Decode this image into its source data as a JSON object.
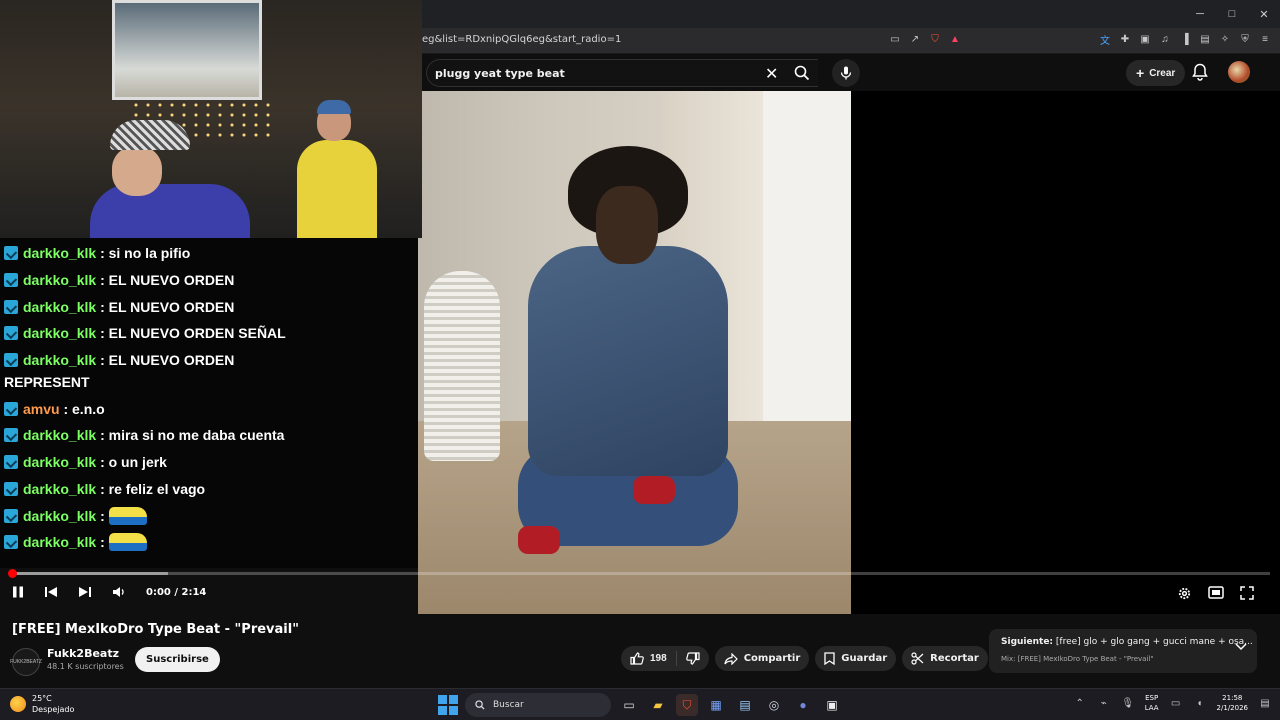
{
  "browser": {
    "url": "eg&list=RDxnipQGlq6eg&start_radio=1",
    "window_controls": [
      "─",
      "□",
      "✕"
    ]
  },
  "youtube": {
    "search_query": "plugg yeat type beat",
    "create_label": "Crear"
  },
  "player": {
    "time": "0:00 / 2:14",
    "progress_fraction": 0.0,
    "buffered_fraction": 0.125
  },
  "chat": {
    "messages": [
      {
        "user": "darkko_klk",
        "text": ": si no la pifio",
        "color": "#7bff63"
      },
      {
        "user": "darkko_klk",
        "text": ": EL NUEVO ORDEN",
        "color": "#7bff63"
      },
      {
        "user": "darkko_klk",
        "text": ": EL NUEVO ORDEN",
        "color": "#7bff63"
      },
      {
        "user": "darkko_klk",
        "text": ": EL NUEVO ORDEN SEÑAL",
        "color": "#7bff63"
      },
      {
        "user": "darkko_klk",
        "text": ": EL NUEVO ORDEN",
        "text2": "REPRESENT",
        "color": "#7bff63"
      },
      {
        "user": "amvu",
        "text": ": e.n.o",
        "color": "#ff9a4d"
      },
      {
        "user": "darkko_klk",
        "text": ": mira si no me daba cuenta",
        "color": "#7bff63"
      },
      {
        "user": "darkko_klk",
        "text": ": o un jerk",
        "color": "#7bff63"
      },
      {
        "user": "darkko_klk",
        "text": ": re feliz el vago",
        "color": "#7bff63"
      },
      {
        "user": "darkko_klk",
        "text": ":",
        "emote": true,
        "color": "#7bff63"
      },
      {
        "user": "darkko_klk",
        "text": ":",
        "emote": true,
        "color": "#7bff63"
      }
    ]
  },
  "video": {
    "title": "[FREE] MexIkoDro Type Beat - \"Prevail\"",
    "channel_name": "Fukk2Beatz",
    "channel_avatar_text": "FUKK2BEATZ",
    "subscribers": "48.1 K suscriptores",
    "subscribe_label": "Suscribirse",
    "likes": "198",
    "share_label": "Compartir",
    "save_label": "Guardar",
    "clip_label": "Recortar"
  },
  "up_next": {
    "label_prefix": "Siguiente:",
    "title": "[free] glo + glo gang + gucci mane + osa...",
    "mix": "Mix: [FREE] MexIkoDro Type Beat - \"Prevail\""
  },
  "taskbar": {
    "temperature": "25°C",
    "weather": "Despejado",
    "search_label": "Buscar",
    "lang_line1": "ESP",
    "lang_line2": "LAA",
    "clock_time": "21:58",
    "clock_date": "2/1/2026"
  },
  "colors": {
    "accent_red": "#ff0000",
    "chat_green": "#7bff63",
    "chat_orange": "#ff9a4d"
  }
}
